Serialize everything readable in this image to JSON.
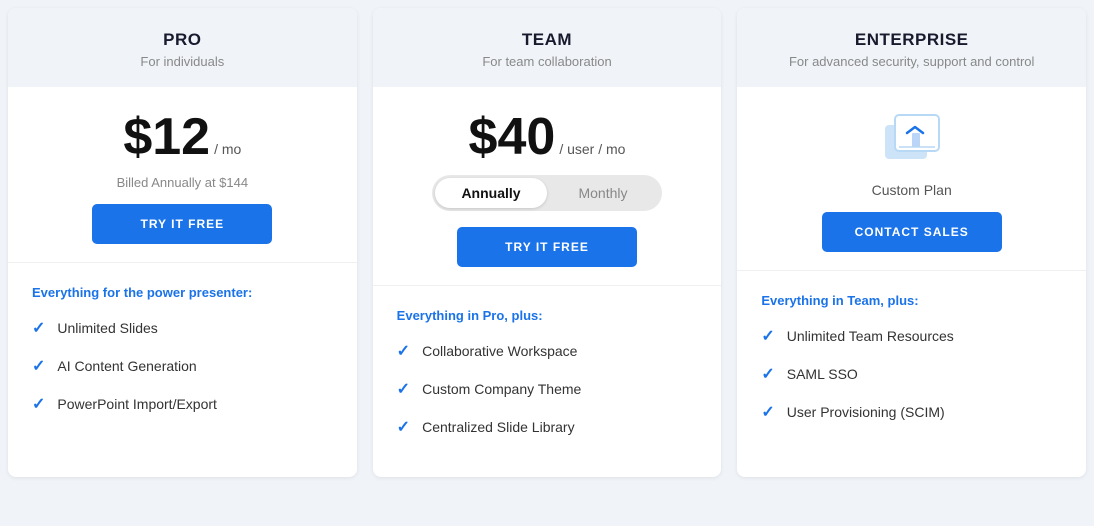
{
  "plans": [
    {
      "id": "pro",
      "name": "PRO",
      "subtitle": "For individuals",
      "price": "$12",
      "price_unit": "/ mo",
      "billed_note": "Billed Annually at $144",
      "cta_label": "TRY IT FREE",
      "cta_type": "primary",
      "show_toggle": false,
      "show_custom": false,
      "features_title": "Everything for the power presenter:",
      "features": [
        "Unlimited Slides",
        "AI Content Generation",
        "PowerPoint Import/Export"
      ]
    },
    {
      "id": "team",
      "name": "TEAM",
      "subtitle": "For team collaboration",
      "price": "$40",
      "price_unit": "/ user / mo",
      "billed_note": "",
      "cta_label": "TRY IT FREE",
      "cta_type": "primary",
      "show_toggle": true,
      "show_custom": false,
      "toggle": {
        "options": [
          "Annually",
          "Monthly"
        ],
        "active": "Annually"
      },
      "features_title": "Everything in Pro, plus:",
      "features": [
        "Collaborative Workspace",
        "Custom Company Theme",
        "Centralized Slide Library"
      ]
    },
    {
      "id": "enterprise",
      "name": "ENTERPRISE",
      "subtitle": "For advanced security, support and control",
      "price": "",
      "price_unit": "",
      "billed_note": "",
      "cta_label": "CONTACT SALES",
      "cta_type": "primary",
      "show_toggle": false,
      "show_custom": true,
      "custom_plan_label": "Custom Plan",
      "features_title": "Everything in Team, plus:",
      "features": [
        "Unlimited Team Resources",
        "SAML SSO",
        "User Provisioning (SCIM)"
      ]
    }
  ],
  "check_symbol": "✓"
}
